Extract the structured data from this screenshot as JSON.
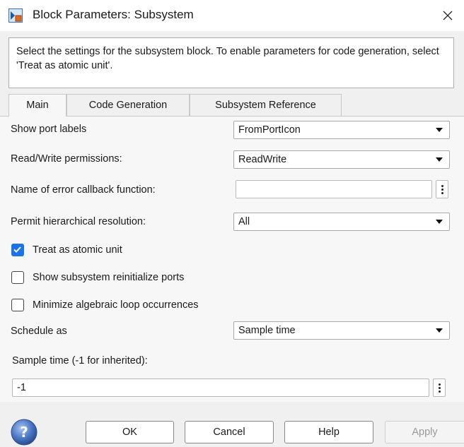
{
  "window": {
    "title": "Block Parameters: Subsystem",
    "app_icon": "simulink-block-icon",
    "close_icon": "close-icon"
  },
  "description": "Select the settings for the subsystem block. To enable parameters for code generation, select 'Treat as atomic unit'.",
  "tabs": [
    {
      "label": "Main",
      "active": true
    },
    {
      "label": "Code Generation",
      "active": false
    },
    {
      "label": "Subsystem Reference",
      "active": false
    }
  ],
  "params": {
    "show_port_labels": {
      "label": "Show port labels",
      "value": "FromPortIcon"
    },
    "read_write": {
      "label": "Read/Write permissions:",
      "value": "ReadWrite"
    },
    "error_callback": {
      "label": "Name of error callback function:",
      "value": ""
    },
    "hierarchical": {
      "label": "Permit hierarchical resolution:",
      "value": "All"
    },
    "treat_atomic": {
      "label": "Treat as atomic unit",
      "checked": true
    },
    "reinit_ports": {
      "label": "Show subsystem reinitialize ports",
      "checked": false
    },
    "minimize_loop": {
      "label": "Minimize algebraic loop occurrences",
      "checked": false
    },
    "schedule_as": {
      "label": "Schedule as",
      "value": "Sample time"
    },
    "sample_time": {
      "label": "Sample time (-1 for inherited):",
      "value": "-1"
    }
  },
  "buttons": {
    "ok": "OK",
    "cancel": "Cancel",
    "help": "Help",
    "apply": "Apply",
    "apply_enabled": false
  },
  "colors": {
    "accent": "#1a73e8",
    "help_icon": "#3f6fb8"
  }
}
